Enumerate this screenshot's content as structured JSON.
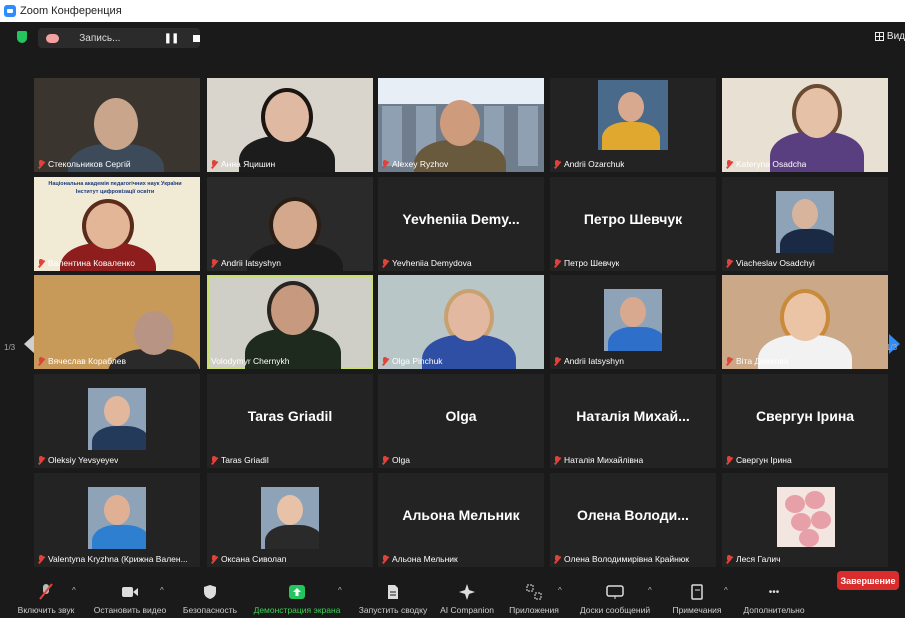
{
  "window": {
    "title": "Zoom Конференция"
  },
  "topbar": {
    "recording_label": "Запись...",
    "pause_glyph": "❚❚",
    "view_label": "Вид"
  },
  "pager": {
    "left": "1/3",
    "right": "1/3"
  },
  "participants": [
    {
      "name": "Стекольников Сергій",
      "video": true
    },
    {
      "name": "Анна Яцишин",
      "video": true
    },
    {
      "name": "Alexey Ryzhov",
      "video": true
    },
    {
      "name": "Andrii Ozarchuk",
      "video": true
    },
    {
      "name": "Kateryna Osadcha",
      "video": true
    },
    {
      "name": "Валентина Коваленко",
      "video": true
    },
    {
      "name": "Andrii Iatsyshyn",
      "video": true
    },
    {
      "name": "Yevheniia Demydova",
      "display": "Yevheniia  Demy...",
      "video": false
    },
    {
      "name": "Петро Шевчук",
      "display": "Петро Шевчук",
      "video": false
    },
    {
      "name": "Viacheslav Osadchyi",
      "video": true
    },
    {
      "name": "Вячеслав Кораблев",
      "video": true
    },
    {
      "name": "Volodymyr Chernykh",
      "video": true,
      "active": true
    },
    {
      "name": "Olga Pinchuk",
      "video": true
    },
    {
      "name": "Andrii Iatsyshyn",
      "video": true
    },
    {
      "name": "Віта Демкова",
      "video": true
    },
    {
      "name": "Oleksiy Yevsyeyev",
      "video": true
    },
    {
      "name": "Taras Griadil",
      "display": "Taras Griadil",
      "video": false
    },
    {
      "name": "Olga",
      "display": "Olga",
      "video": false
    },
    {
      "name": "Наталія Михайлівна",
      "display": "Наталія Михай...",
      "video": false
    },
    {
      "name": "Свергун Ірина",
      "display": "Свергун Ірина",
      "video": false
    },
    {
      "name": "Valentyna Kryzhna (Крижна Вален...",
      "video": true
    },
    {
      "name": "Оксана Сиволап",
      "video": true
    },
    {
      "name": "Альона Мельник",
      "display": "Альона Мельник",
      "video": false
    },
    {
      "name": "Олена Володимирівна Крайнюк",
      "display": "Олена  Володи...",
      "video": false
    },
    {
      "name": "Леся Галич",
      "video": true
    }
  ],
  "slide_texts": {
    "nan_title_1": "Національна академія педагогічних наук України",
    "nan_title_2": "Інститут цифровізації освіти"
  },
  "toolbar": {
    "unmute": "Включить звук",
    "stop_video": "Остановить видео",
    "security": "Безопасность",
    "share": "Демонстрация экрана",
    "summary": "Запустить сводку",
    "ai": "AI Companion",
    "apps": "Приложения",
    "whiteboards": "Доски сообщений",
    "notes": "Примечания",
    "more": "Дополнительно",
    "end": "Завершение",
    "caret": "^",
    "more_glyph": "•••"
  },
  "colors": {
    "accent": "#2d8cff",
    "active_speaker": "#c8e06a",
    "end": "#d92d2d",
    "share": "#39d353",
    "muted": "#e0433a"
  }
}
